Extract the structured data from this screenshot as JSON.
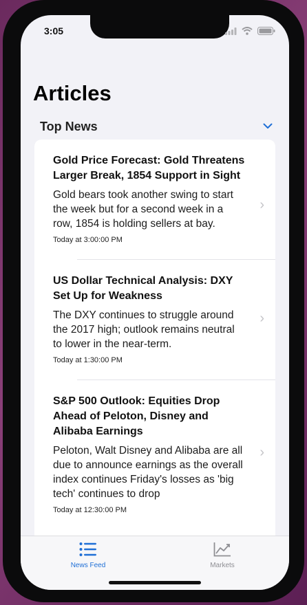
{
  "status_bar": {
    "time": "3:05"
  },
  "page": {
    "title": "Articles"
  },
  "section": {
    "title": "Top News"
  },
  "articles": [
    {
      "title": "Gold Price Forecast: Gold Threatens Larger Break, 1854 Support in Sight",
      "summary": "Gold bears took another swing to start the week but for a second week in a row, 1854 is holding sellers at bay.",
      "time": "Today at 3:00:00 PM"
    },
    {
      "title": "US Dollar Technical Analysis: DXY Set Up for Weakness",
      "summary": "The DXY continues to struggle around the 2017 high; outlook remains neutral to lower in the near-term.",
      "time": "Today at 1:30:00 PM"
    },
    {
      "title": "S&P 500 Outlook: Equities Drop Ahead of Peloton, Disney and Alibaba Earnings",
      "summary": "Peloton, Walt Disney and Alibaba are all due to announce earnings as the overall index continues Friday's losses as 'big tech' continues to drop",
      "time": "Today at 12:30:00 PM"
    }
  ],
  "tab_bar": {
    "tabs": [
      {
        "label": "News Feed",
        "icon": "list-icon",
        "selected": true
      },
      {
        "label": "Markets",
        "icon": "chart-line-icon",
        "selected": false
      }
    ]
  },
  "colors": {
    "accent": "#1f6fd6",
    "inactive": "#8e8e93"
  }
}
